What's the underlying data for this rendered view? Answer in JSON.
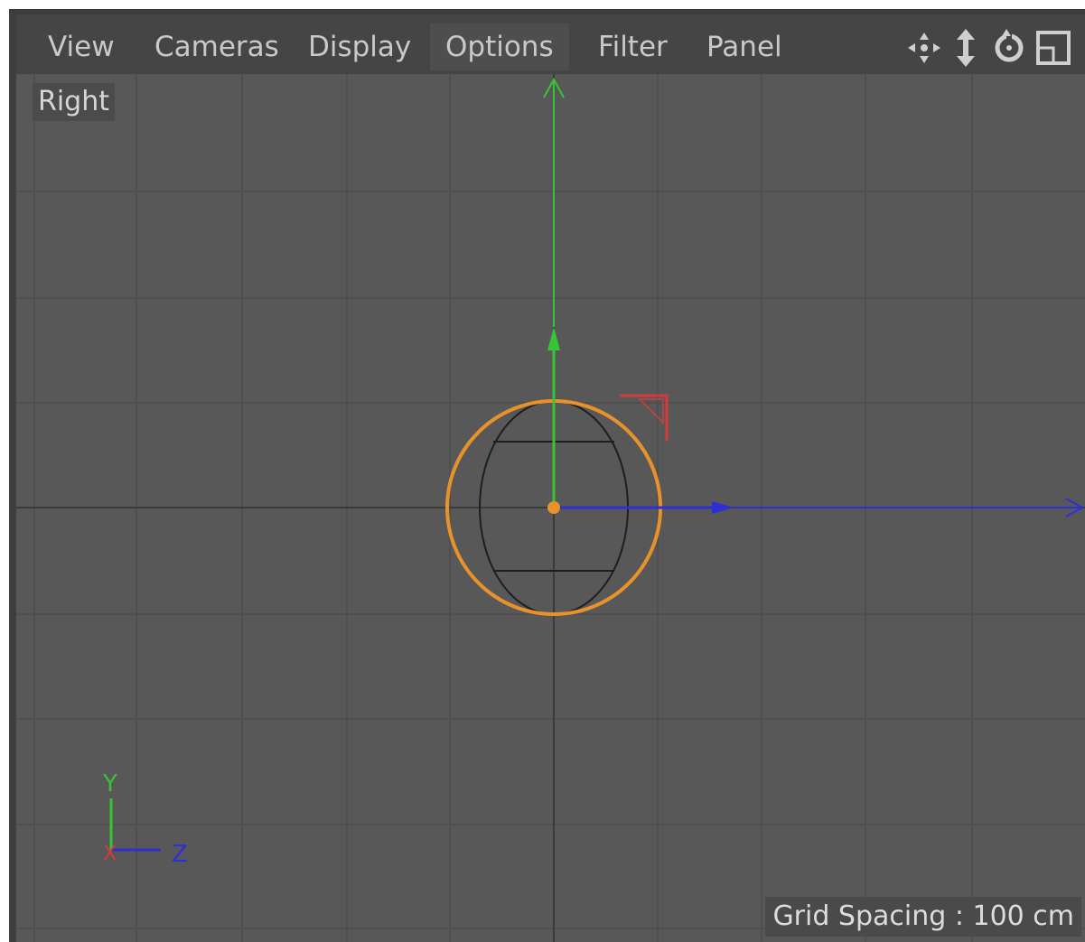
{
  "menu": {
    "items": [
      {
        "label": "View",
        "active": false
      },
      {
        "label": "Cameras",
        "active": false
      },
      {
        "label": "Display",
        "active": false
      },
      {
        "label": "Options",
        "active": true
      },
      {
        "label": "Filter",
        "active": false
      },
      {
        "label": "Panel",
        "active": false
      }
    ]
  },
  "toolbar": {
    "icons": [
      "move-view-icon",
      "dolly-view-icon",
      "rotate-view-icon",
      "toggle-layout-icon"
    ]
  },
  "viewport": {
    "camera_label": "Right",
    "grid_spacing_label": "Grid Spacing :",
    "grid_spacing_value": "100 cm"
  },
  "axis_gizmo": {
    "y_label": "Y",
    "z_label": "Z",
    "x_label": "X"
  },
  "colors": {
    "background": "#585858",
    "menubar": "#454545",
    "grid": "#4f4f4f",
    "selection": "#e8922a",
    "axis_x": "#d23c3c",
    "axis_y": "#37c437",
    "axis_z": "#2f2fd6"
  }
}
